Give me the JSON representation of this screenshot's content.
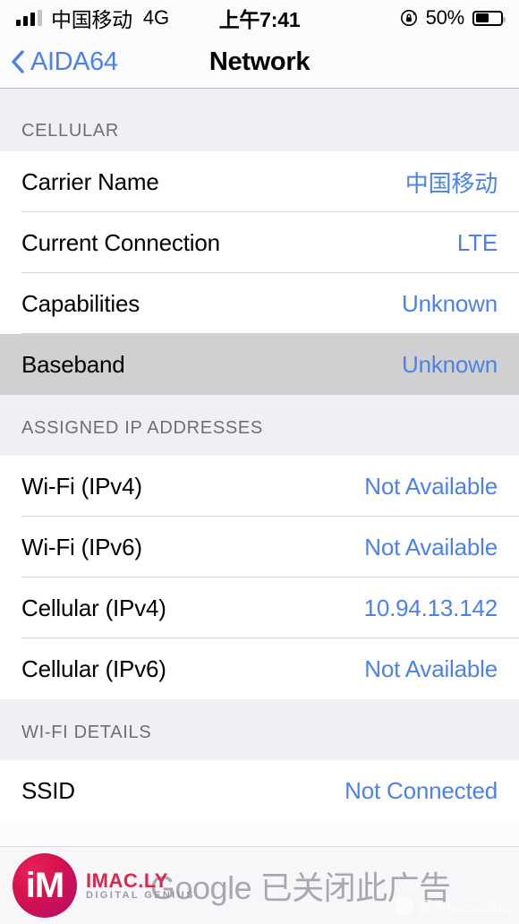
{
  "status_bar": {
    "signal_bars_filled": 3,
    "signal_bars_total": 4,
    "carrier": "中国移动",
    "network_type": "4G",
    "time": "上午7:41",
    "rotation_lock_icon": "rotation-lock-icon",
    "battery_percent": "50%",
    "battery_level": 50
  },
  "nav": {
    "back_label": "AIDA64",
    "back_icon": "chevron-left-icon",
    "title": "Network"
  },
  "sections": [
    {
      "header": "CELLULAR",
      "rows": [
        {
          "label": "Carrier Name",
          "value": "中国移动",
          "selected": false
        },
        {
          "label": "Current Connection",
          "value": "LTE",
          "selected": false
        },
        {
          "label": "Capabilities",
          "value": "Unknown",
          "selected": false
        },
        {
          "label": "Baseband",
          "value": "Unknown",
          "selected": true
        }
      ]
    },
    {
      "header": "ASSIGNED IP ADDRESSES",
      "rows": [
        {
          "label": "Wi-Fi (IPv4)",
          "value": "Not Available",
          "selected": false
        },
        {
          "label": "Wi-Fi (IPv6)",
          "value": "Not Available",
          "selected": false
        },
        {
          "label": "Cellular (IPv4)",
          "value": "10.94.13.142",
          "selected": false
        },
        {
          "label": "Cellular (IPv6)",
          "value": "Not Available",
          "selected": false
        }
      ]
    },
    {
      "header": "WI-FI DETAILS",
      "rows": [
        {
          "label": "SSID",
          "value": "Not Connected",
          "selected": false
        }
      ]
    }
  ],
  "footer": {
    "ad_text": "Google 已关闭此广告",
    "watermark_logo_text": "iM",
    "watermark_title": "IMAC.LY",
    "watermark_subtitle": "DIGITAL GENIUS",
    "corner_watermark": "爱iPhone论坛"
  },
  "colors": {
    "accent_blue": "#4b82e8",
    "section_bg": "#eff0f3",
    "selected_row_bg": "#d0d0d3",
    "separator": "#d3d3d6",
    "label_gray": "#6e6e73",
    "logo_red": "#d8294e"
  }
}
